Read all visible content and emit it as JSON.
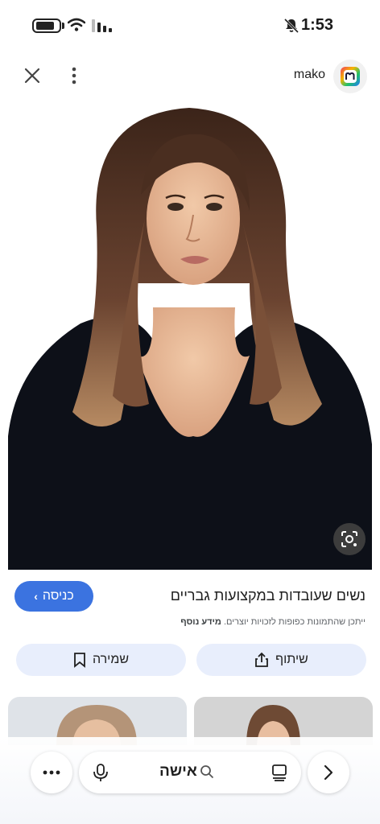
{
  "status_bar": {
    "time": "1:53"
  },
  "top_bar": {
    "site_name": "mako"
  },
  "result": {
    "title": "נשים שעובדות במקצועות גבריים",
    "visit_label": "כניסה",
    "copyright_text": "ייתכן שהתמונות כפופות לזכויות יוצרים.",
    "more_info_label": "מידע נוסף",
    "share_label": "שיתוף",
    "save_label": "שמירה"
  },
  "bottom_nav": {
    "search_query": "אישה"
  },
  "colors": {
    "accent": "#3b73e0",
    "action_button_bg": "#e8eefc"
  },
  "icons": {
    "close": "close-icon",
    "more": "more-vertical-icon",
    "logo": "mako-logo",
    "lens": "lens-icon",
    "share": "share-icon",
    "save": "bookmark-icon",
    "mic": "mic-icon",
    "search": "search-icon",
    "tabs": "tabs-icon",
    "forward": "chevron-right-icon",
    "menu": "more-horizontal-icon"
  }
}
